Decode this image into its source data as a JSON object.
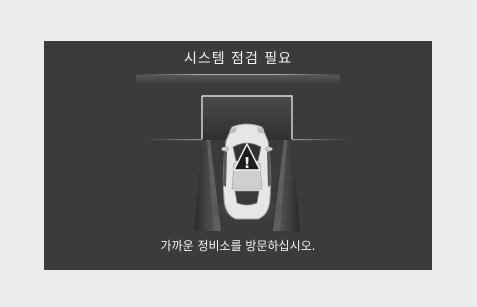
{
  "dialog": {
    "title": "시스템 점검 필요",
    "message": "가까운 정비소를 방문하십시오."
  },
  "warning": {
    "icon": "warning-triangle-icon",
    "symbol": "!"
  },
  "colors": {
    "screen_background": "#3b3b3b",
    "page_background": "#ececec",
    "text": "#f2f2f2",
    "car_body": "#e6e6e6"
  }
}
